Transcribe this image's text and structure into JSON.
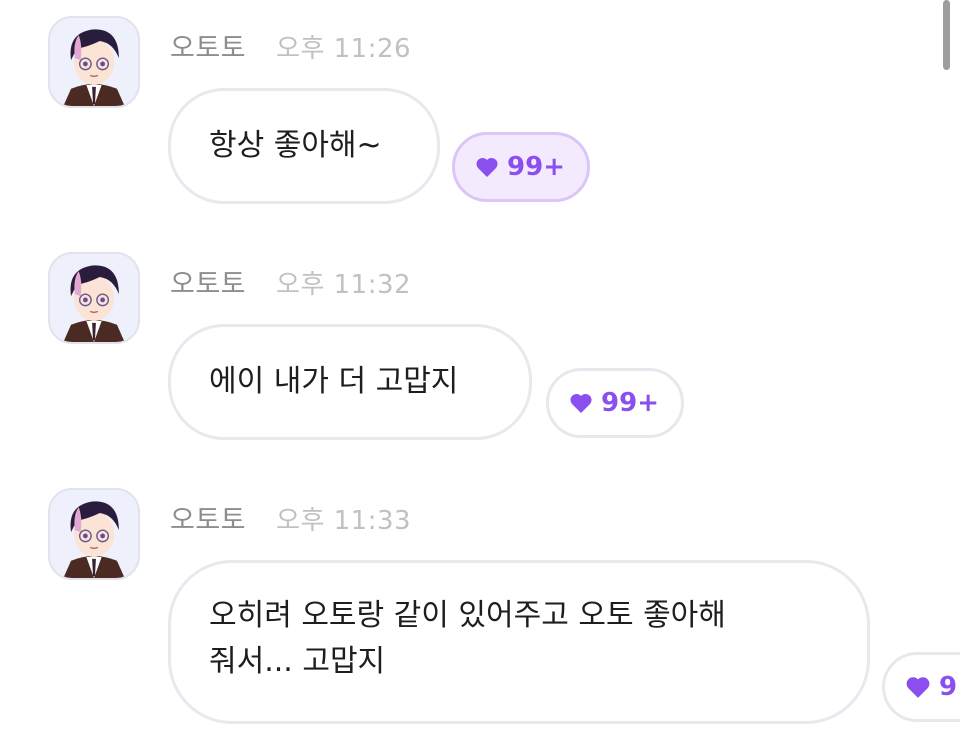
{
  "messages": [
    {
      "sender": "오토토",
      "time": "오후 11:26",
      "text": "항상 좋아해~",
      "reaction": {
        "icon": "heart-icon",
        "count": "99+",
        "active": true
      }
    },
    {
      "sender": "오토토",
      "time": "오후 11:32",
      "text": "에이 내가 더 고맙지",
      "reaction": {
        "icon": "heart-icon",
        "count": "99+",
        "active": false
      }
    },
    {
      "sender": "오토토",
      "time": "오후 11:33",
      "text": "오히려 오토랑 같이 있어주고 오토 좋아해\n줘서... 고맙지",
      "reaction": {
        "icon": "heart-icon",
        "count": "9",
        "active": false
      }
    }
  ],
  "colors": {
    "accent": "#8b4ff0",
    "active_reaction_bg": "#f3eafd",
    "sender": "#8d8d8d",
    "time": "#c1c1c1"
  }
}
